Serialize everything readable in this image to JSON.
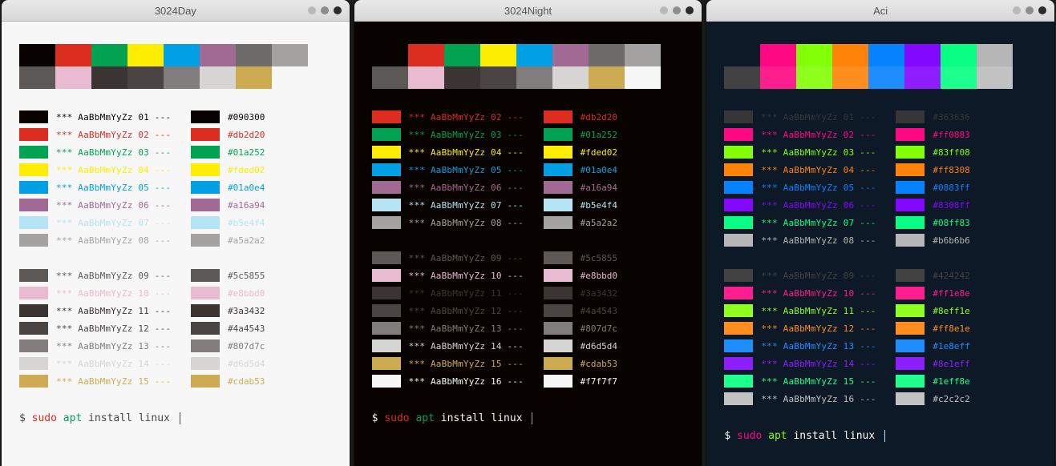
{
  "sample_text_prefix": "*** AaBbMmYyZz ",
  "sample_text_suffix": " ---",
  "prompt": {
    "symbol": "$ ",
    "sudo": "sudo ",
    "apt": "apt ",
    "rest": "install linux "
  },
  "themes": [
    {
      "name": "3024Day",
      "bg": "#f7f7f7",
      "fg": "#4a4543",
      "cursor": "#4a4543",
      "prompt_colors": {
        "sym": "#4a4543",
        "sudo": "#db2d20",
        "apt": "#01a252",
        "rest": "#4a4543"
      },
      "palette_top": [
        "#090300",
        "#db2d20",
        "#01a252",
        "#fded02",
        "#01a0e4",
        "#a16a94",
        "#6e6c6a",
        "#a5a2a2"
      ],
      "palette_bottom": [
        "#5c5855",
        "#e8bbd0",
        "#3a3432",
        "#4a4543",
        "#807d7c",
        "#d6d5d4",
        "#cdab53",
        "#f7f7f7"
      ],
      "rows": [
        {
          "n": "01",
          "fg": "#090300",
          "box": "#090300",
          "hex": "#090300",
          "box2": "#090300"
        },
        {
          "n": "02",
          "fg": "#db2d20",
          "box": "#db2d20",
          "hex": "#db2d20",
          "box2": "#db2d20"
        },
        {
          "n": "03",
          "fg": "#01a252",
          "box": "#01a252",
          "hex": "#01a252",
          "box2": "#01a252"
        },
        {
          "n": "04",
          "fg": "#fded02",
          "box": "#fded02",
          "hex": "#fded02",
          "box2": "#fded02"
        },
        {
          "n": "05",
          "fg": "#01a0e4",
          "box": "#01a0e4",
          "hex": "#01a0e4",
          "box2": "#01a0e4"
        },
        {
          "n": "06",
          "fg": "#a16a94",
          "box": "#a16a94",
          "hex": "#a16a94",
          "box2": "#a16a94"
        },
        {
          "n": "07",
          "fg": "#b5e4f4",
          "box": "#b5e4f4",
          "hex": "#b5e4f4",
          "box2": "#b5e4f4"
        },
        {
          "n": "08",
          "fg": "#a5a2a2",
          "box": "#a5a2a2",
          "hex": "#a5a2a2",
          "box2": "#a5a2a2"
        },
        null,
        {
          "n": "09",
          "fg": "#5c5855",
          "box": "#5c5855",
          "hex": "#5c5855",
          "box2": "#5c5855"
        },
        {
          "n": "10",
          "fg": "#e8bbd0",
          "box": "#e8bbd0",
          "hex": "#e8bbd0",
          "box2": "#e8bbd0"
        },
        {
          "n": "11",
          "fg": "#3a3432",
          "box": "#3a3432",
          "hex": "#3a3432",
          "box2": "#3a3432"
        },
        {
          "n": "12",
          "fg": "#4a4543",
          "box": "#4a4543",
          "hex": "#4a4543",
          "box2": "#4a4543"
        },
        {
          "n": "13",
          "fg": "#807d7c",
          "box": "#807d7c",
          "hex": "#807d7c",
          "box2": "#807d7c"
        },
        {
          "n": "14",
          "fg": "#d6d5d4",
          "box": "#d6d5d4",
          "hex": "#d6d5d4",
          "box2": "#d6d5d4"
        },
        {
          "n": "15",
          "fg": "#cdab53",
          "box": "#cdab53",
          "hex": "#cdab53",
          "box2": "#cdab53"
        }
      ]
    },
    {
      "name": "3024Night",
      "bg": "#090300",
      "fg": "#a5a2a2",
      "cursor": "#a5a2a2",
      "prompt_colors": {
        "sym": "#f7f7f7",
        "sudo": "#db2d20",
        "apt": "#01a252",
        "rest": "#f7f7f7"
      },
      "palette_top": [
        "#090300",
        "#db2d20",
        "#01a252",
        "#fded02",
        "#01a0e4",
        "#a16a94",
        "#6e6c6a",
        "#a5a2a2"
      ],
      "palette_bottom": [
        "#5c5855",
        "#e8bbd0",
        "#3a3432",
        "#4a4543",
        "#807d7c",
        "#d6d5d4",
        "#cdab53",
        "#f7f7f7"
      ],
      "rows": [
        {
          "n": "02",
          "fg": "#db2d20",
          "box": "#db2d20",
          "hex": "#db2d20",
          "box2": "#db2d20"
        },
        {
          "n": "03",
          "fg": "#01a252",
          "box": "#01a252",
          "hex": "#01a252",
          "box2": "#01a252"
        },
        {
          "n": "04",
          "fg": "#fded02",
          "box": "#fded02",
          "hex": "#fded02",
          "box2": "#fded02"
        },
        {
          "n": "05",
          "fg": "#01a0e4",
          "box": "#01a0e4",
          "hex": "#01a0e4",
          "box2": "#01a0e4"
        },
        {
          "n": "06",
          "fg": "#a16a94",
          "box": "#a16a94",
          "hex": "#a16a94",
          "box2": "#a16a94"
        },
        {
          "n": "07",
          "fg": "#b5e4f4",
          "box": "#b5e4f4",
          "hex": "#b5e4f4",
          "box2": "#b5e4f4"
        },
        {
          "n": "08",
          "fg": "#a5a2a2",
          "box": "#a5a2a2",
          "hex": "#a5a2a2",
          "box2": "#a5a2a2"
        },
        null,
        {
          "n": "09",
          "fg": "#5c5855",
          "box": "#5c5855",
          "hex": "#5c5855",
          "box2": "#5c5855"
        },
        {
          "n": "10",
          "fg": "#e8bbd0",
          "box": "#e8bbd0",
          "hex": "#e8bbd0",
          "box2": "#e8bbd0"
        },
        {
          "n": "11",
          "fg": "#3a3432",
          "box": "#3a3432",
          "hex": "#3a3432",
          "box2": "#3a3432"
        },
        {
          "n": "12",
          "fg": "#4a4543",
          "box": "#4a4543",
          "hex": "#4a4543",
          "box2": "#4a4543"
        },
        {
          "n": "13",
          "fg": "#807d7c",
          "box": "#807d7c",
          "hex": "#807d7c",
          "box2": "#807d7c"
        },
        {
          "n": "14",
          "fg": "#d6d5d4",
          "box": "#d6d5d4",
          "hex": "#d6d5d4",
          "box2": "#d6d5d4"
        },
        {
          "n": "15",
          "fg": "#cdab53",
          "box": "#cdab53",
          "hex": "#cdab53",
          "box2": "#cdab53"
        },
        {
          "n": "16",
          "fg": "#f7f7f7",
          "box": "#f7f7f7",
          "hex": "#f7f7f7",
          "box2": "#f7f7f7"
        }
      ]
    },
    {
      "name": "Aci",
      "bg": "#0d1926",
      "fg": "#b4e1fd",
      "cursor": "#b4e1fd",
      "prompt_colors": {
        "sym": "#ffffff",
        "sudo": "#ff0883",
        "apt": "#83ff08",
        "rest": "#ffffff"
      },
      "palette_top": [
        "#0d1926",
        "#ff0883",
        "#83ff08",
        "#ff8308",
        "#0883ff",
        "#8308ff",
        "#08ff83",
        "#b6b6b6"
      ],
      "palette_bottom": [
        "#424242",
        "#ff1e8e",
        "#8eff1e",
        "#ff8e1e",
        "#1e8eff",
        "#8e1eff",
        "#1eff8e",
        "#c2c2c2"
      ],
      "rows": [
        {
          "n": "01",
          "fg": "#363636",
          "box": "#363636",
          "hex": "#363636",
          "box2": "#363636"
        },
        {
          "n": "02",
          "fg": "#ff0883",
          "box": "#ff0883",
          "hex": "#ff0883",
          "box2": "#ff0883"
        },
        {
          "n": "03",
          "fg": "#83ff08",
          "box": "#83ff08",
          "hex": "#83ff08",
          "box2": "#83ff08"
        },
        {
          "n": "04",
          "fg": "#ff8308",
          "box": "#ff8308",
          "hex": "#ff8308",
          "box2": "#ff8308"
        },
        {
          "n": "05",
          "fg": "#0883ff",
          "box": "#0883ff",
          "hex": "#0883ff",
          "box2": "#0883ff"
        },
        {
          "n": "06",
          "fg": "#8308ff",
          "box": "#8308ff",
          "hex": "#8308ff",
          "box2": "#8308ff"
        },
        {
          "n": "07",
          "fg": "#08ff83",
          "box": "#08ff83",
          "hex": "#08ff83",
          "box2": "#08ff83"
        },
        {
          "n": "08",
          "fg": "#b6b6b6",
          "box": "#b6b6b6",
          "hex": "#b6b6b6",
          "box2": "#b6b6b6"
        },
        null,
        {
          "n": "09",
          "fg": "#424242",
          "box": "#424242",
          "hex": "#424242",
          "box2": "#424242"
        },
        {
          "n": "10",
          "fg": "#ff1e8e",
          "box": "#ff1e8e",
          "hex": "#ff1e8e",
          "box2": "#ff1e8e"
        },
        {
          "n": "11",
          "fg": "#8eff1e",
          "box": "#8eff1e",
          "hex": "#8eff1e",
          "box2": "#8eff1e"
        },
        {
          "n": "12",
          "fg": "#ff8e1e",
          "box": "#ff8e1e",
          "hex": "#ff8e1e",
          "box2": "#ff8e1e"
        },
        {
          "n": "13",
          "fg": "#1e8eff",
          "box": "#1e8eff",
          "hex": "#1e8eff",
          "box2": "#1e8eff"
        },
        {
          "n": "14",
          "fg": "#8e1eff",
          "box": "#8e1eff",
          "hex": "#8e1eff",
          "box2": "#8e1eff"
        },
        {
          "n": "15",
          "fg": "#1eff8e",
          "box": "#1eff8e",
          "hex": "#1eff8e",
          "box2": "#1eff8e"
        },
        {
          "n": "16",
          "fg": "#c2c2c2",
          "box": "#c2c2c2",
          "hex": "#c2c2c2",
          "box2": "#c2c2c2"
        }
      ]
    }
  ]
}
